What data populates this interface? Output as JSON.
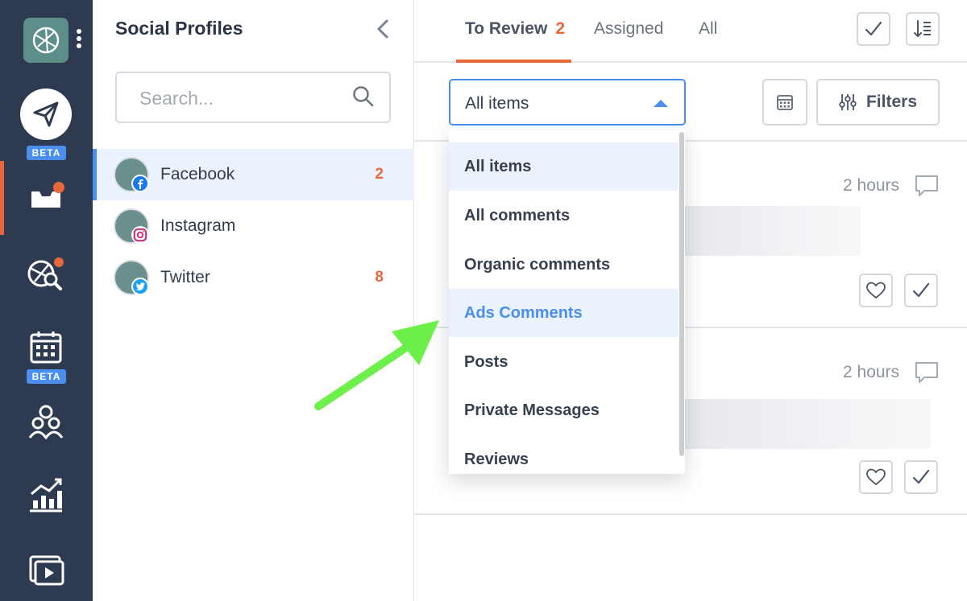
{
  "sidebar": {
    "badges": {
      "publish": "BETA",
      "calendar": "BETA"
    },
    "icons": [
      "publish-icon",
      "inbox-icon",
      "listening-icon",
      "calendar-icon",
      "team-icon",
      "analytics-icon",
      "library-icon"
    ],
    "notification_color": "#e8683c"
  },
  "profiles": {
    "title": "Social Profiles",
    "search_placeholder": "Search...",
    "items": [
      {
        "name": "Facebook",
        "count": "2",
        "network": "facebook"
      },
      {
        "name": "Instagram",
        "count": "",
        "network": "instagram"
      },
      {
        "name": "Twitter",
        "count": "8",
        "network": "twitter"
      }
    ]
  },
  "tabs": [
    {
      "label": "To Review",
      "count": "2"
    },
    {
      "label": "Assigned"
    },
    {
      "label": "All"
    }
  ],
  "filter": {
    "selected": "All items",
    "filters_label": "Filters",
    "options": [
      "All items",
      "All comments",
      "Organic comments",
      "Ads Comments",
      "Posts",
      "Private Messages",
      "Reviews"
    ],
    "highlighted": "Ads Comments"
  },
  "cards": [
    {
      "time": "2 hours"
    },
    {
      "time": "2 hours"
    }
  ],
  "colors": {
    "rail": "#2e3a4f",
    "accent": "#4a8ff0",
    "orange": "#e8683c",
    "annotation_arrow": "#6ef04a"
  }
}
